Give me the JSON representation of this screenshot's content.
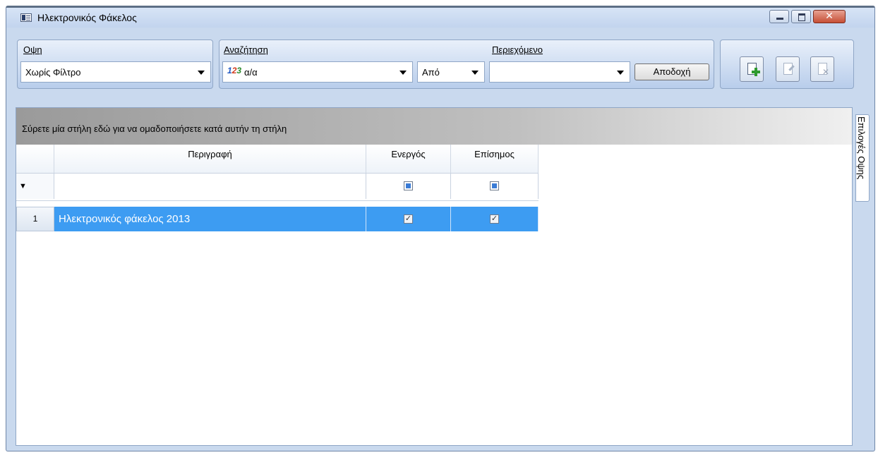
{
  "window": {
    "title": "Ηλεκτρονικός Φάκελος",
    "close_symbol": "✕"
  },
  "view_group": {
    "label": "Οψη",
    "filter_value": "Χωρίς Φίλτρο"
  },
  "search_group": {
    "label": "Αναζήτηση",
    "field_value": "α/α",
    "operator_value": "Από",
    "content_label": "Περιεχόμενο",
    "content_value": "",
    "accept_label": "Αποδοχή"
  },
  "grid": {
    "group_hint": "Σύρετε μία στήλη εδώ για να ομαδοποιήσετε κατά αυτήν τη στήλη",
    "columns": [
      "Περιγραφή",
      "Ενεργός",
      "Επίσημος"
    ],
    "rows": [
      {
        "num": "1",
        "description": "Ηλεκτρονικός φάκελος 2013",
        "active": true,
        "official": true
      }
    ]
  },
  "side_tab": {
    "label": "Επιλογές Οψης"
  },
  "icons": {
    "numeric_field": "123-icon"
  }
}
